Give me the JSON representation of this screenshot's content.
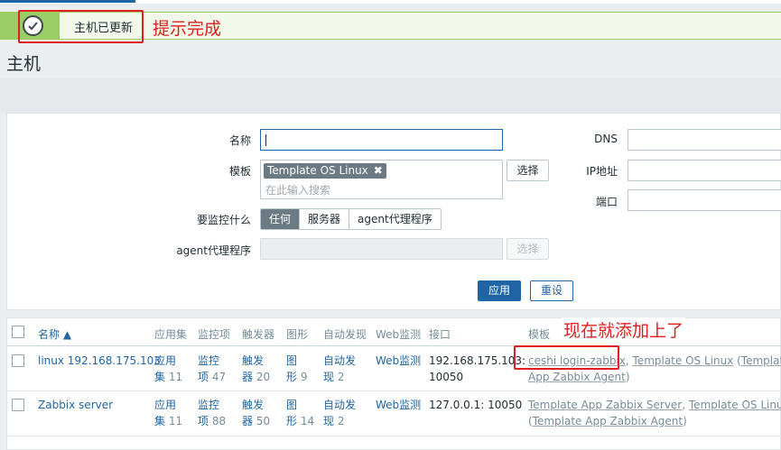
{
  "message": {
    "text": "主机已更新"
  },
  "annotations": {
    "top": "提示完成",
    "table": "现在就添加上了"
  },
  "page": {
    "title": "主机"
  },
  "filter": {
    "name_label": "名称",
    "name_value": "",
    "templates_label": "模板",
    "template_chip": "Template OS Linux",
    "template_chip_remove": "✖",
    "template_placeholder": "在此输入搜索",
    "select_button": "选择",
    "monitor_label": "要监控什么",
    "monitor_options": [
      "任何",
      "服务器",
      "agent代理程序"
    ],
    "monitor_selected": "任何",
    "proxy_label": "agent代理程序",
    "proxy_select_button": "选择",
    "dns_label": "DNS",
    "ip_label": "IP地址",
    "port_label": "端口",
    "apply_button": "应用",
    "reset_button": "重设"
  },
  "table": {
    "headers": {
      "name": "名称 ▲",
      "applications": "应用集",
      "items": "监控项",
      "triggers": "触发器",
      "graphs": "图形",
      "discovery": "自动发现",
      "web": "Web监测",
      "interface": "接口",
      "templates": "模板"
    },
    "rows": [
      {
        "name": "linux 192.168.175.103",
        "app_l1": "应用",
        "app_l2": "集",
        "app_count": "11",
        "items_l1": "监控",
        "items_l2": "项",
        "items_count": "47",
        "trig_l1": "触发",
        "trig_l2": "器",
        "trig_count": "20",
        "graph_l1": "图",
        "graph_l2": "形",
        "graph_count": "9",
        "disc_l1": "自动发",
        "disc_l2": "现",
        "disc_count": "2",
        "web": "Web监测",
        "iface_l1": "192.168.175.103:",
        "iface_l2": "10050",
        "tpl_t1": "ceshi login-zabbix",
        "tpl_sep1": ", ",
        "tpl_t2": "Template OS Linux",
        "tpl_open": " (",
        "tpl_t3a": "Template",
        "tpl_t3b": "App Zabbix Agent",
        "tpl_close": ")"
      },
      {
        "name": "Zabbix server",
        "app_l1": "应用",
        "app_l2": "集",
        "app_count": "11",
        "items_l1": "监控",
        "items_l2": "项",
        "items_count": "88",
        "trig_l1": "触发",
        "trig_l2": "器",
        "trig_count": "50",
        "graph_l1": "图",
        "graph_l2": "形",
        "graph_count": "14",
        "disc_l1": "自动发",
        "disc_l2": "现",
        "disc_count": "2",
        "web": "Web监测",
        "iface_l1": "127.0.0.1: 10050",
        "tpl_t1": "Template App Zabbix Server",
        "tpl_sep1": ", ",
        "tpl_t2": "Template OS Linux",
        "tpl_open": "(",
        "tpl_t3": "Template App Zabbix Agent",
        "tpl_close": ")"
      }
    ]
  },
  "colors": {
    "accent": "#1f65a6",
    "success": "#9ccc65",
    "annotation": "#e02020"
  }
}
